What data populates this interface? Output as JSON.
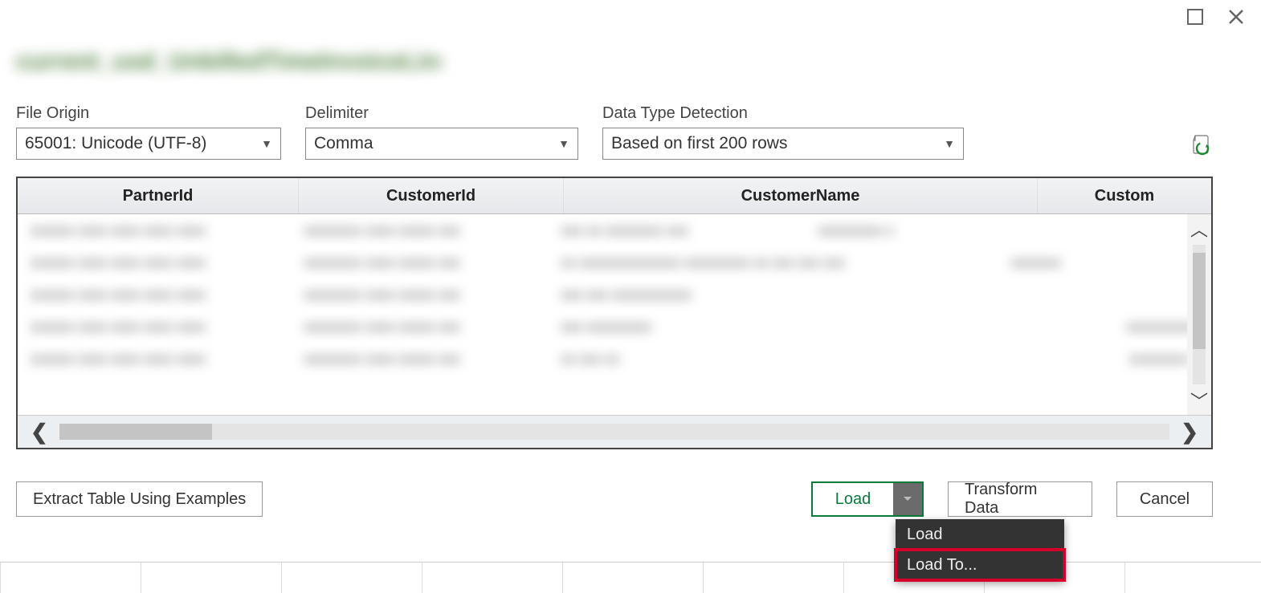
{
  "title_blurred": "current_usd_UnbilledTimeInvoiceLineIte .csv",
  "options": {
    "file_origin": {
      "label": "File Origin",
      "value": "65001: Unicode (UTF-8)"
    },
    "delimiter": {
      "label": "Delimiter",
      "value": "Comma"
    },
    "data_type_detection": {
      "label": "Data Type Detection",
      "value": "Based on first 200 rows"
    }
  },
  "columns": [
    "PartnerId",
    "CustomerId",
    "CustomerName",
    "Custom"
  ],
  "footer": {
    "extract": "Extract Table Using Examples",
    "load": "Load",
    "transform": "Transform Data",
    "cancel": "Cancel"
  },
  "load_menu": {
    "items": [
      "Load",
      "Load To..."
    ],
    "highlightIndex": 1
  }
}
